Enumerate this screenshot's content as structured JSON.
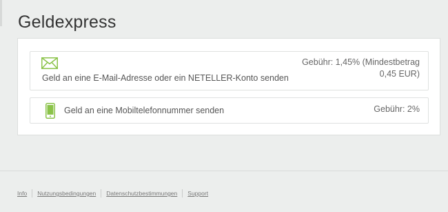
{
  "page": {
    "title": "Geldexpress"
  },
  "options": [
    {
      "label": "Geld an eine E-Mail-Adresse oder ein NETELLER-Konto senden",
      "fee_line1": "Gebühr: 1,45% (Mindestbetrag",
      "fee_line2": "0,45 EUR)",
      "icon": "envelope-icon"
    },
    {
      "label": "Geld an eine Mobiltelefonnummer senden",
      "fee_line1": "Gebühr: 2%",
      "icon": "mobile-phone-icon"
    }
  ],
  "footer": {
    "links": [
      "Info",
      "Nutzungsbedingungen",
      "Datenschutzbestimmungen",
      "Support"
    ]
  },
  "colors": {
    "accent": "#8bc34a"
  }
}
